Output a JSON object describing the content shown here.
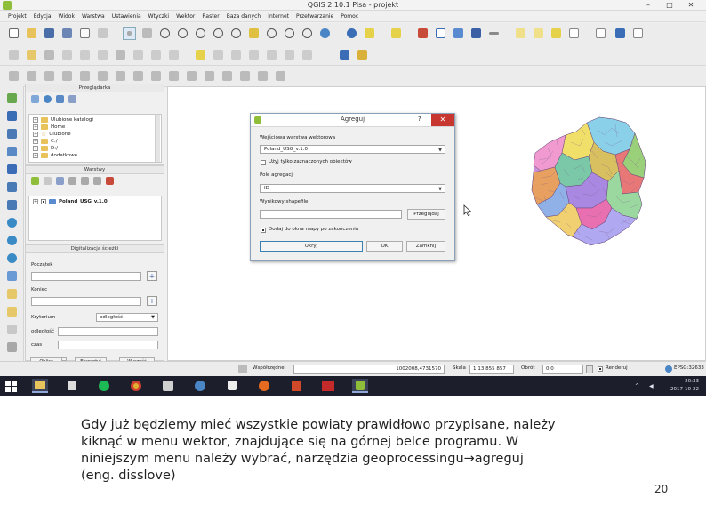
{
  "window": {
    "title": "QGIS 2.10.1 Pisa - projekt",
    "buttons": [
      "–",
      "□",
      "✕"
    ]
  },
  "menubar": [
    "Projekt",
    "Edycja",
    "Widok",
    "Warstwa",
    "Ustawienia",
    "Wtyczki",
    "Wektor",
    "Raster",
    "Baza danych",
    "Internet",
    "Przetwarzanie",
    "Pomoc"
  ],
  "browser_panel": {
    "title": "Przeglądarka",
    "items": [
      "Ulubione katalogi",
      "Home",
      "Ulubione",
      "C:/",
      "D:/",
      "dodatkowe"
    ]
  },
  "layers_panel": {
    "title": "Warstwy",
    "layer": "Poland_USG_v.1.0"
  },
  "digitize_panel": {
    "title": "Digitalizacja ścieżki",
    "start_label": "Początek",
    "end_label": "Koniec",
    "criterion_label": "Kryterium",
    "criterion_value": "odległość",
    "distance_label": "odległość",
    "time_label": "czas",
    "buttons": [
      "Oblicz",
      "Eksportuj",
      "Wyczyść"
    ]
  },
  "statusbar": {
    "coordinate_label": "Współrzędne",
    "coordinate_value": "1002008,4731570",
    "scale_label": "Skala",
    "scale_value": "1:13 855 857",
    "rotation_label": "Obrót",
    "rotation_value": "0,0",
    "render_label": "Renderuj",
    "crs_label": "EPSG:32633"
  },
  "dialog": {
    "title": "Agreguj",
    "help": "?",
    "close": "✕",
    "input_label": "Wejściowa warstwa wektorowa",
    "input_value": "Poland_USG_v.1.0",
    "selected_only_label": "Użyj tylko zaznaczonych obiektów",
    "field_label": "Pole agregacji",
    "field_value": "ID",
    "output_label": "Wynikowy shapefile",
    "browse_button": "Przeglądaj",
    "add_to_map_label": "Dodaj do okna mapy po zakończeniu",
    "buttons": [
      "Ukryj",
      "OK",
      "Zamknij"
    ]
  },
  "taskbar": {
    "time": "20:33",
    "date": "2017-10-22"
  },
  "caption": {
    "lines": [
      "Gdy już będziemy mieć wszystkie powiaty prawidłowo przypisane, należy",
      "kiknąć w menu wektor, znajdujące się na górnej belce programu. W",
      "niniejszym menu należy wybrać, narzędzia geoprocessingu→agreguj",
      "(eng. disslove)"
    ],
    "page_number": "20"
  }
}
